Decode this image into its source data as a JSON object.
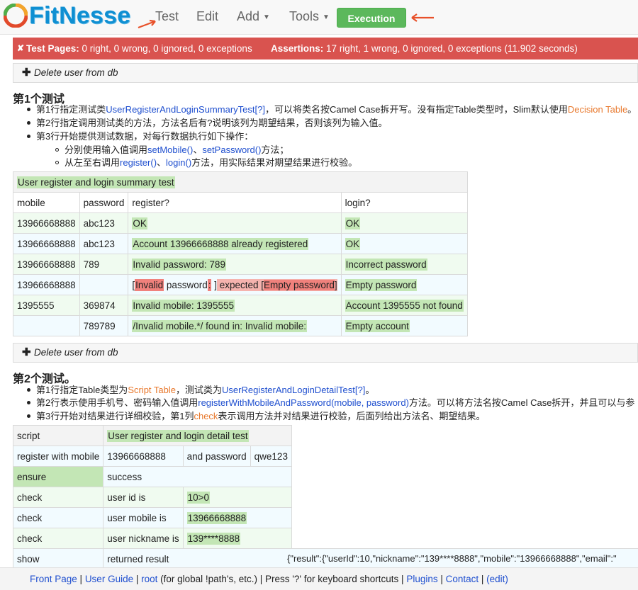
{
  "header": {
    "logo_text": "FitNesse",
    "nav": {
      "test": "Test",
      "edit": "Edit",
      "add": "Add",
      "tools": "Tools",
      "exec_log": "Execution Log"
    }
  },
  "result": {
    "test_pages_label": "Test Pages:",
    "test_pages_value": "0 right, 0 wrong, 0 ignored, 0 exceptions",
    "assertions_label": "Assertions:",
    "assertions_value": "17 right, 1 wrong, 0 ignored, 0 exceptions (11.902 seconds)"
  },
  "collapsible_label": "Delete user from db",
  "section1": {
    "title": "第1个测试",
    "b1_pre": "第1行指定测试类",
    "b1_link": "UserRegisterAndLoginSummaryTest",
    "b1_q": "[?]",
    "b1_mid": "，可以将类名按Camel Case拆开写。没有指定Table类型时，Slim默认使用",
    "b1_tail": "Decision Table",
    "b1_end": "。",
    "b2": "第2行指定调用测试类的方法，方法名后有?说明该列为期望结果，否则该列为输入值。",
    "b3": "第3行开始提供测试数据，对每行数据执行如下操作：",
    "s1_pre": "分别使用输入值调用",
    "s1_link1": "setMobile()",
    "s1_sep": "、",
    "s1_link2": "setPassword()",
    "s1_end": "方法；",
    "s2_pre": "从左至右调用",
    "s2_link1": "register()",
    "s2_sep": "、",
    "s2_link2": "login()",
    "s2_end": "方法，用实际结果对期望结果进行校验。"
  },
  "table1": {
    "title": "User register and login summary test",
    "headers": [
      "mobile",
      "password",
      "register?",
      "login?"
    ],
    "rows": [
      [
        "13966668888",
        "abc123",
        "OK",
        "OK"
      ],
      [
        "13966668888",
        "abc123",
        "Account 13966668888 already registered",
        "OK"
      ],
      [
        "13966668888",
        "789",
        "Invalid password: 789",
        "Incorrect password"
      ],
      [
        "13966668888",
        "",
        "",
        "Empty password"
      ],
      [
        "1395555",
        "369874",
        "Invalid mobile: 1395555",
        "Account 1395555 not found"
      ],
      [
        "",
        "789789",
        "/Invalid mobile.*/ found in: Invalid mobile:",
        "Empty account"
      ]
    ],
    "fail_cell": {
      "open": "[",
      "invalid": "Invalid",
      "password": " password",
      "colon": ":",
      "close": " ]",
      "expected": " expected ",
      "exp_open": "[",
      "exp_value": "Empty password",
      "exp_close": "]"
    }
  },
  "section2": {
    "title": "第2个测试。",
    "b1_pre": "第1行指定Table类型为",
    "b1_tail": "Script Table",
    "b1_mid": "，测试类为",
    "b1_link": "UserRegisterAndLoginDetailTest",
    "b1_q": "[?]",
    "b1_end": "。",
    "b2_pre": "第2行表示使用手机号、密码输入值调用",
    "b2_link": "registerWithMobileAndPassword(mobile, password)",
    "b2_end": "方法。可以将方法名按Camel Case拆开，并且可以与参",
    "b3_pre": "第3行开始对结果进行详细校验，第1列",
    "b3_check": "check",
    "b3_end": "表示调用方法并对结果进行校验，后面列给出方法名、期望结果。"
  },
  "table2": {
    "r0": [
      "script",
      "User register and login detail test"
    ],
    "r1": [
      "register with mobile",
      "13966668888",
      "and password",
      "qwe123"
    ],
    "r2": [
      "ensure",
      "success"
    ],
    "r3": [
      "check",
      "user id is",
      "10>0"
    ],
    "r4": [
      "check",
      "user mobile is",
      "13966668888"
    ],
    "r5": [
      "check",
      "user nickname is",
      "139****8888"
    ],
    "r6": [
      "show",
      "returned result",
      "{\"result\":{\"userId\":10,\"nickname\":\"139****8888\",\"mobile\":\"13966668888\",\"email\":\""
    ]
  },
  "footer": {
    "front_page": "Front Page",
    "sep": " | ",
    "user_guide": "User Guide",
    "root": "root",
    "root_note": " (for global !path's, etc.)",
    "press": "Press '?' for keyboard shortcuts",
    "plugins": "Plugins",
    "contact": "Contact",
    "edit": "(edit)"
  },
  "colors": {
    "pass": "#c3e6b5",
    "fail": "#d9534f",
    "brand": "#0f8fd2",
    "button": "#5cb85c"
  }
}
